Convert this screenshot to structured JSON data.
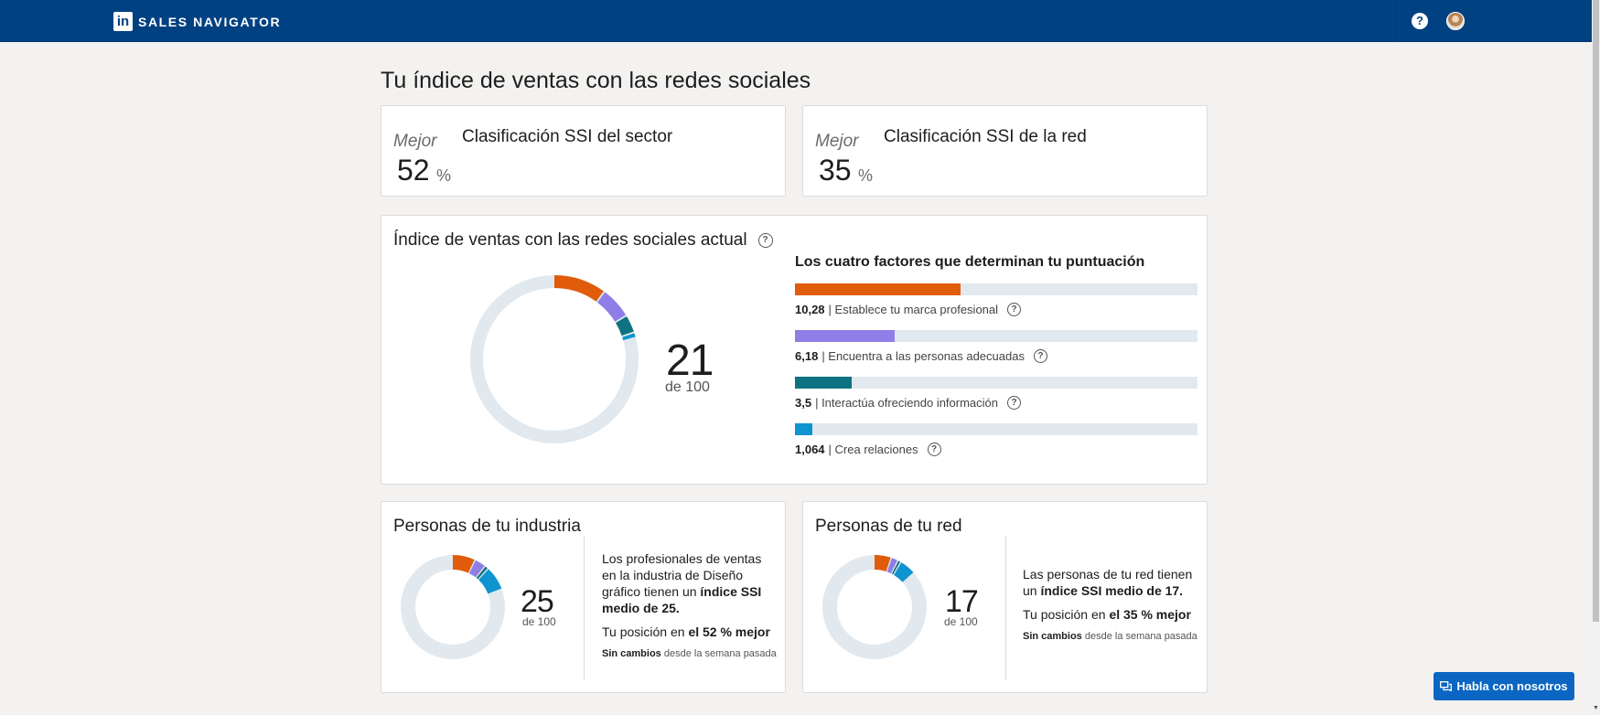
{
  "topbar": {
    "logo": "in",
    "brand": "SALES NAVIGATOR",
    "help_icon": "?",
    "bg": "#004182"
  },
  "page": {
    "title": "Tu índice de ventas con las redes sociales"
  },
  "rank_cards": [
    {
      "better": "Mejor",
      "value": "52",
      "unit": "%",
      "title": "Clasificación SSI del sector"
    },
    {
      "better": "Mejor",
      "value": "35",
      "unit": "%",
      "title": "Clasificación SSI de la red"
    }
  ],
  "ssi": {
    "title": "Índice de ventas con las redes sociales actual",
    "help_icon": "?",
    "score": "21",
    "of": "de 100",
    "factors_title": "Los cuatro factores que determinan tu puntuación",
    "factors": [
      {
        "value": "10,28",
        "label": "| Establece tu marca profesional",
        "score": 10.28,
        "max": 25,
        "color": "#e15c0a"
      },
      {
        "value": "6,18",
        "label": "| Encuentra a las personas adecuadas",
        "score": 6.18,
        "max": 25,
        "color": "#8f7ee8"
      },
      {
        "value": "3,5",
        "label": "| Interactúa ofreciendo información",
        "score": 3.5,
        "max": 25,
        "color": "#0e7380"
      },
      {
        "value": "1,064",
        "label": "| Crea relaciones",
        "score": 1.064,
        "max": 25,
        "color": "#0f94cf"
      }
    ]
  },
  "industry": {
    "title": "Personas de tu industria",
    "score": "25",
    "of": "de 100",
    "text_plain": "Los profesionales de ventas en la industria de Diseño gráfico tienen un ",
    "text_bold": "índice SSI medio de 25.",
    "position_plain": "Tu posición en ",
    "position_bold": "el 52 % mejor",
    "note_bold": "Sin cambios",
    "note_plain": " desde la semana pasada",
    "segments": [
      7.2,
      3.6,
      1.2,
      7.6
    ]
  },
  "network": {
    "title": "Personas de tu red",
    "score": "17",
    "of": "de 100",
    "text_plain": "Las personas de tu red tienen un ",
    "text_bold": "índice SSI medio de 17.",
    "position_plain": "Tu posición en ",
    "position_bold": "el 35 % mejor",
    "note_bold": "Sin cambios",
    "note_plain": " desde la semana pasada",
    "segments": [
      5.4,
      2.2,
      1.0,
      5.2
    ]
  },
  "chat": {
    "label": "Habla con nosotros",
    "bg": "#0a66c2"
  }
}
